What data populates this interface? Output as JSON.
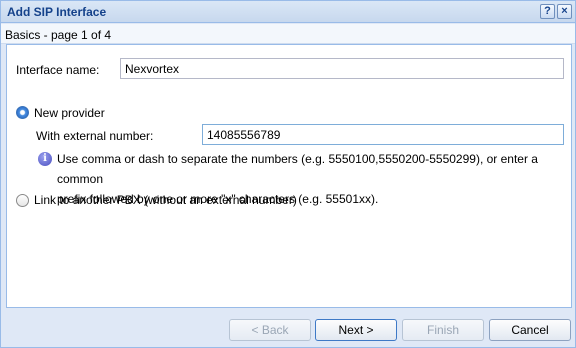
{
  "window": {
    "title": "Add SIP Interface",
    "help_icon": "?",
    "close_icon": "×"
  },
  "header": {
    "page_label": "Basics - page 1 of 4"
  },
  "form": {
    "interface_name_label": "Interface name:",
    "interface_name_value": "Nexvortex",
    "new_provider_label": "New provider",
    "new_provider_selected": true,
    "external_number_label": "With external number:",
    "external_number_value": "14085556789",
    "hint_line1": "Use comma or dash to separate the numbers (e.g. 5550100,5550200-5550299), or enter a common",
    "hint_line2": "prefix followed by one or more \"x\" characters (e.g. 55501xx).",
    "link_pbx_label": "Link to another PBX (without an external number)",
    "link_pbx_selected": false
  },
  "footer": {
    "back_label": "< Back",
    "next_label": "Next >",
    "finish_label": "Finish",
    "cancel_label": "Cancel"
  }
}
